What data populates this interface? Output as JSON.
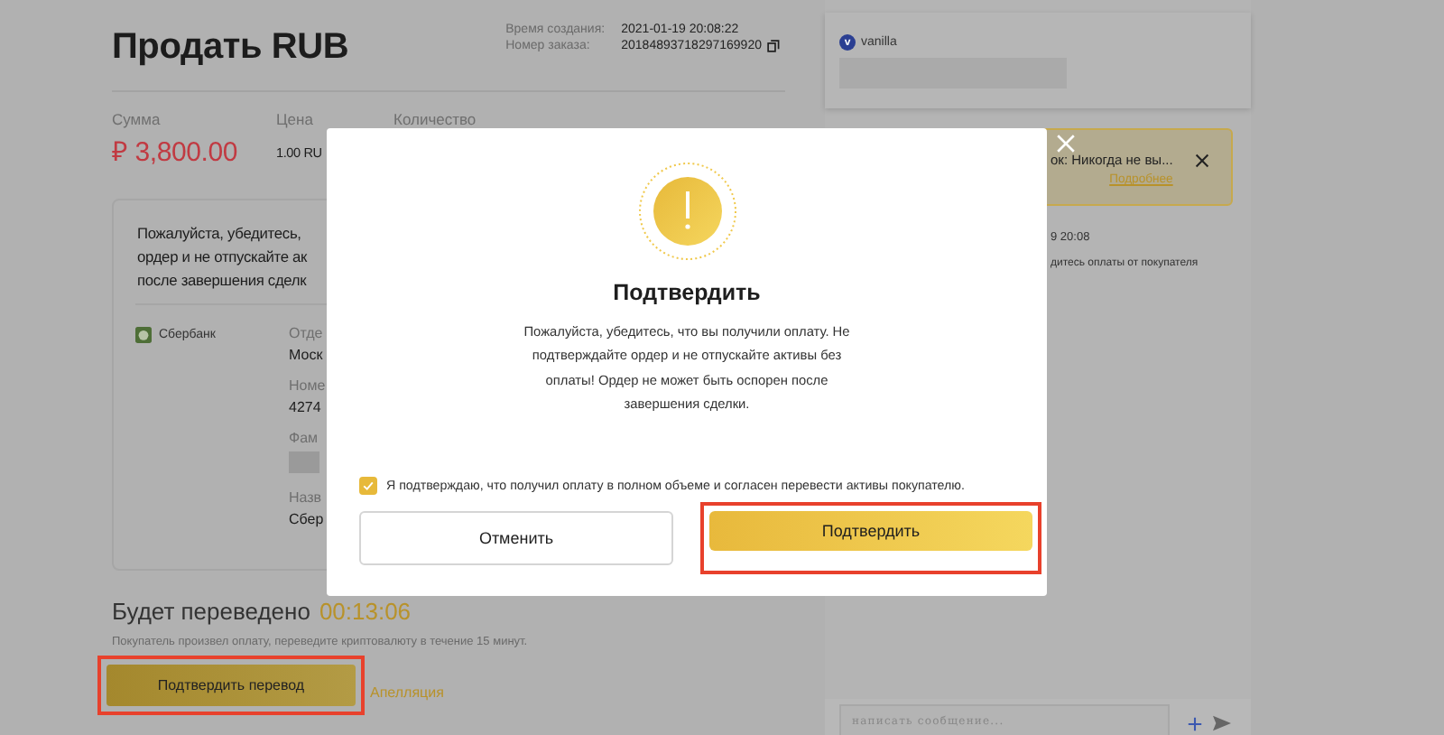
{
  "header": {
    "title": "Продать RUB",
    "meta": [
      {
        "label": "Время создания:",
        "value": "2021-01-19 20:08:22",
        "copy": false
      },
      {
        "label": "Номер заказа:",
        "value": "20184893718297169920",
        "copy": true
      }
    ]
  },
  "summary": [
    {
      "label": "Сумма",
      "value": "₽ 3,800.00",
      "kind": "amount"
    },
    {
      "label": "Цена",
      "value": "1.00 RU",
      "kind": "plain"
    },
    {
      "label": "Количество"
    }
  ],
  "payment_card": {
    "notice_lines": [
      "Пожалуйста, убедитесь,",
      "ордер и не отпускайте ак",
      "после завершения сделк"
    ],
    "bank": "Сбербанк",
    "details": [
      {
        "kind": "label",
        "text": "Отде"
      },
      {
        "kind": "value",
        "text": "Моск"
      },
      {
        "kind": "label",
        "text": "Номе"
      },
      {
        "kind": "value",
        "text": "4274"
      },
      {
        "kind": "label",
        "text": "Фам"
      },
      {
        "kind": "masked"
      },
      {
        "kind": "label",
        "text": "Назв"
      },
      {
        "kind": "value",
        "text": "Сбер"
      }
    ]
  },
  "transfer": {
    "heading": "Будет переведено",
    "timer": "00:13:06",
    "note": "Покупатель произвел оплату, переведите криптовалюту в течение 15 минут.",
    "button": {
      "label": "Подтвердить перевод",
      "highlighted": true
    },
    "appeal": "Апелляция"
  },
  "chat": {
    "avatar": "v",
    "user": "vanilla",
    "banner": {
      "text": "ок: Никогда не вы...",
      "link": "Подробнее"
    },
    "time": "9 20:08",
    "message": "дитесь оплаты от покупателя",
    "input": {
      "placeholder": "написать сообщение..."
    }
  },
  "modal": {
    "title": "Подтвердить",
    "message": "Пожалуйста, убедитесь, что вы получили оплату. Не подтверждайте ордер и не отпускайте активы без оплаты! Ордер не может быть оспорен после завершения сделки.",
    "agree": {
      "label": "Я подтверждаю, что получил оплату в полном объеме и согласен перевести активы покупателю.",
      "checked": true
    },
    "buttons": [
      {
        "label": "Отменить",
        "kind": "secondary",
        "highlighted": false
      },
      {
        "label": "Подтвердить",
        "kind": "primary",
        "highlighted": true
      }
    ]
  }
}
